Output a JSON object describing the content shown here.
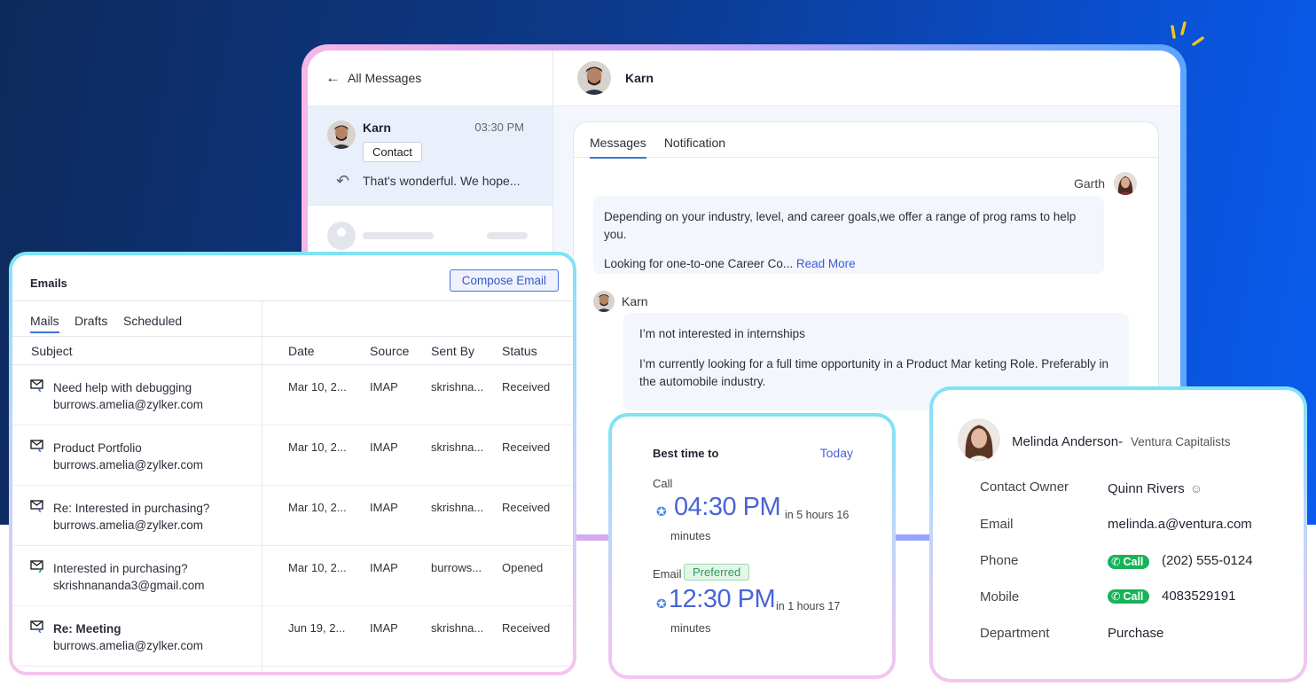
{
  "colors": {
    "accent": "#4a64d6",
    "background": "#0c3a8c",
    "call_green": "#17b35a"
  },
  "messages": {
    "back_label": "All Messages",
    "conversation": {
      "name": "Karn",
      "time": "03:30 PM",
      "tag": "Contact",
      "preview": "That's wonderful. We hope..."
    },
    "header_name": "Karn",
    "tabs": [
      "Messages",
      "Notification"
    ],
    "thread": {
      "sender1": "Garth",
      "bubble1_line1": "Depending on  your industry, level, and career goals,we offer a  range of prog rams to help  you.",
      "bubble1_line2": "Looking for one-to-one Career Co...",
      "read_more": "Read More",
      "sender2": "Karn",
      "bubble2_line1": "I’m not interested in internships",
      "bubble2_line2": "I’m currently looking for a full time opportunity in a Product Mar  keting Role. Preferably in the automobile industry."
    }
  },
  "emails": {
    "title": "Emails",
    "compose_label": "Compose Email",
    "tabs": [
      "Mails",
      "Drafts",
      "Scheduled"
    ],
    "columns": [
      "Subject",
      "Date",
      "Source",
      "Sent By",
      "Status"
    ],
    "rows": [
      {
        "subject": "Need help with debugging",
        "address": "burrows.amelia@zylker.com",
        "date": "Mar 10, 2...",
        "source": "IMAP",
        "sent_by": "skrishna...",
        "status": "Received"
      },
      {
        "subject": "Product Portfolio",
        "address": "burrows.amelia@zylker.com",
        "date": "Mar 10, 2...",
        "source": "IMAP",
        "sent_by": "skrishna...",
        "status": "Received"
      },
      {
        "subject": "Re: Interested in purchasing?",
        "address": "burrows.amelia@zylker.com",
        "date": "Mar 10, 2...",
        "source": "IMAP",
        "sent_by": "skrishna...",
        "status": "Received"
      },
      {
        "subject": "Interested in purchasing?",
        "address": "skrishnananda3@gmail.com",
        "date": "Mar 10, 2...",
        "source": "IMAP",
        "sent_by": "burrows...",
        "status": "Opened"
      },
      {
        "subject": "Re: Meeting",
        "address": "burrows.amelia@zylker.com",
        "date": "Jun 19, 2...",
        "source": "IMAP",
        "sent_by": "skrishna...",
        "status": "Received"
      }
    ]
  },
  "best_time": {
    "title": "Best time to",
    "period": "Today",
    "call_label": "Call",
    "call_time": "04:30 PM",
    "call_rel": "in 5 hours 16",
    "call_rel2": "minutes",
    "email_label": "Email",
    "preferred_label": "Preferred",
    "email_time": "12:30 PM",
    "email_rel": "in 1 hours 17",
    "email_rel2": "minutes"
  },
  "contact": {
    "name": "Melinda Anderson-",
    "company": "Ventura Capitalists",
    "fields": [
      {
        "label": "Contact Owner",
        "value": "Quinn Rivers"
      },
      {
        "label": "Email",
        "value": "melinda.a@ventura.com"
      },
      {
        "label": "Phone",
        "value": "(202) 555-0124",
        "call": "Call"
      },
      {
        "label": "Mobile",
        "value": "4083529191",
        "call": "Call"
      },
      {
        "label": "Department",
        "value": "Purchase"
      }
    ]
  }
}
